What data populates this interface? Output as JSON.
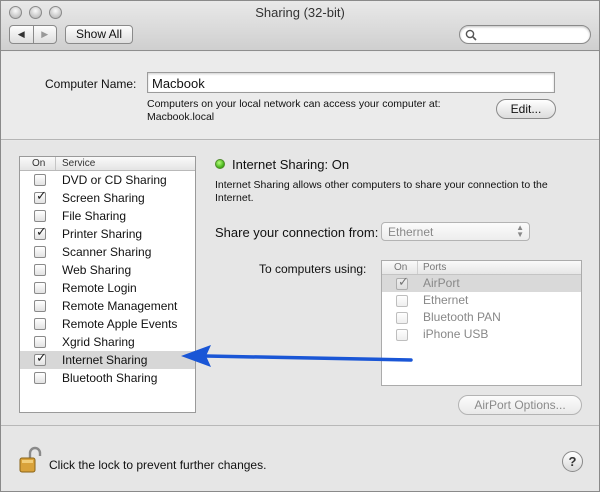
{
  "window": {
    "title": "Sharing (32-bit)"
  },
  "toolbar": {
    "back_icon": "◀",
    "forward_icon": "▶",
    "show_all_label": "Show All",
    "search_placeholder": ""
  },
  "computer_name": {
    "label": "Computer Name:",
    "value": "Macbook",
    "note_line1": "Computers on your local network can access your computer at:",
    "note_line2": "Macbook.local",
    "edit_label": "Edit..."
  },
  "services": {
    "header_on": "On",
    "header_service": "Service",
    "items": [
      {
        "label": "DVD or CD Sharing",
        "checked": false
      },
      {
        "label": "Screen Sharing",
        "checked": true
      },
      {
        "label": "File Sharing",
        "checked": false
      },
      {
        "label": "Printer Sharing",
        "checked": true
      },
      {
        "label": "Scanner Sharing",
        "checked": false
      },
      {
        "label": "Web Sharing",
        "checked": false
      },
      {
        "label": "Remote Login",
        "checked": false
      },
      {
        "label": "Remote Management",
        "checked": false
      },
      {
        "label": "Remote Apple Events",
        "checked": false
      },
      {
        "label": "Xgrid Sharing",
        "checked": false
      },
      {
        "label": "Internet Sharing",
        "checked": true,
        "selected": true
      },
      {
        "label": "Bluetooth Sharing",
        "checked": false
      }
    ]
  },
  "detail": {
    "status": "Internet Sharing: On",
    "status_color": "#3fae16",
    "description": "Internet Sharing allows other computers to share your connection to the Internet.",
    "share_from_label": "Share your connection from:",
    "share_from_value": "Ethernet",
    "to_computers_label": "To computers using:",
    "ports_header_on": "On",
    "ports_header_ports": "Ports",
    "ports": [
      {
        "label": "AirPort",
        "checked": true,
        "selected": true
      },
      {
        "label": "Ethernet",
        "checked": false
      },
      {
        "label": "Bluetooth PAN",
        "checked": false
      },
      {
        "label": "iPhone USB",
        "checked": false
      }
    ],
    "airport_options_label": "AirPort Options..."
  },
  "footer": {
    "lock_text": "Click the lock to prevent further changes.",
    "help_label": "?"
  },
  "annotation": {
    "arrow_color": "#1a56d6"
  }
}
